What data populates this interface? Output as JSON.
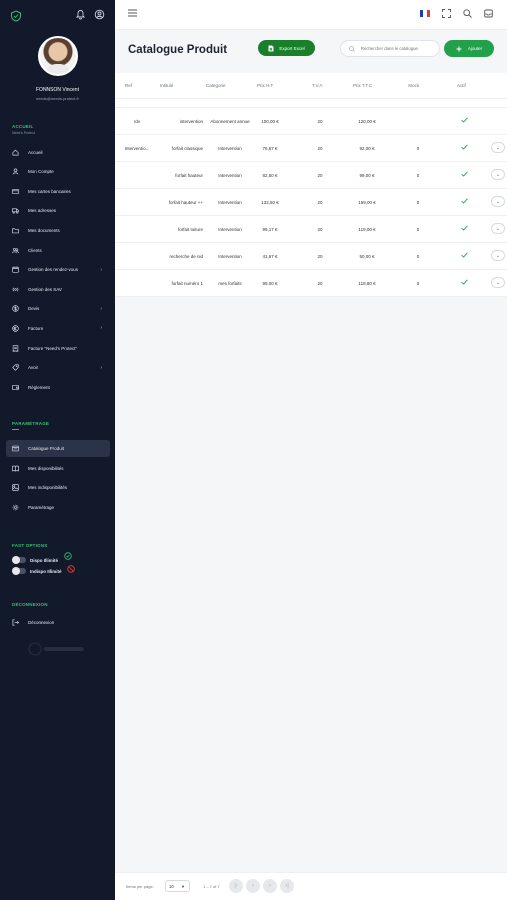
{
  "user": {
    "name": "FONNSON Vincent",
    "email": "needs@needs-protect.fr"
  },
  "sidebar": {
    "section_access": "ACCUEIL",
    "section_access_sub": "Need's Protect",
    "items": [
      {
        "label": "Accueil",
        "icon": "home-icon",
        "arrow": ""
      },
      {
        "label": "Mon Compte",
        "icon": "user-icon",
        "arrow": ""
      },
      {
        "label": "Mes cartes bancaires",
        "icon": "card-icon",
        "arrow": ""
      },
      {
        "label": "Mes adresses",
        "icon": "truck-icon",
        "arrow": ""
      },
      {
        "label": "Mes documents",
        "icon": "folder-icon",
        "arrow": ""
      },
      {
        "label": "Clients",
        "icon": "users-icon",
        "arrow": ""
      },
      {
        "label": "Gestion des rendez-vous",
        "icon": "calendar-icon",
        "arrow": "›"
      },
      {
        "label": "Gestion des SAV",
        "icon": "radio-icon",
        "arrow": ""
      },
      {
        "label": "Devis",
        "icon": "dollar-icon",
        "arrow": "›"
      },
      {
        "label": "Facture",
        "icon": "euro-icon",
        "arrow": "›"
      },
      {
        "label": "Facture \"Need's Protect\"",
        "icon": "receipt-icon",
        "arrow": ""
      },
      {
        "label": "Avoir",
        "icon": "tag-icon",
        "arrow": "›"
      },
      {
        "label": "Règlement",
        "icon": "wallet-icon",
        "arrow": ""
      }
    ],
    "section_settings": "PARAMÉTRAGE",
    "settings_items": [
      {
        "label": "Catalogue Produit",
        "icon": "catalog-icon"
      },
      {
        "label": "Mes disponibilités",
        "icon": "book-icon"
      },
      {
        "label": "Mes indisponibilités",
        "icon": "image-icon"
      },
      {
        "label": "Paramétrage",
        "icon": "gear-icon"
      }
    ],
    "section_fast": "FAST OPTIONS",
    "toggles": [
      {
        "label": "Dispo Illimité"
      },
      {
        "label": "Indispo Illimité"
      }
    ],
    "section_logout": "DÉCONNEXION",
    "logout_label": "Déconnexion"
  },
  "header": {
    "title": "Catalogue Produit",
    "export_label": "Export Excel",
    "search_placeholder": "Rechercher dans le catalogue",
    "add_label": "Ajouter"
  },
  "table": {
    "columns": [
      "Ref",
      "Intitulé",
      "Categorie",
      "Prix H.T",
      "T.V.A",
      "Prix T.T.C",
      "Stock",
      "Actif"
    ],
    "rows": [
      {
        "ref": "rdv",
        "intitule": "intervention",
        "categorie": "Abonnement annue",
        "prix_ht": "100,00 €",
        "tva": "20",
        "prix_ttc": "120,00 €",
        "stock": "",
        "actif": true,
        "expand": false
      },
      {
        "ref": "Interventio...",
        "intitule": "forfait classique",
        "categorie": "Intervention",
        "prix_ht": "76,67 €",
        "tva": "20",
        "prix_ttc": "92,00 €",
        "stock": "0",
        "actif": true,
        "expand": true
      },
      {
        "ref": "",
        "intitule": "forfait hauteur",
        "categorie": "Intervention",
        "prix_ht": "82,50 €",
        "tva": "20",
        "prix_ttc": "99,00 €",
        "stock": "0",
        "actif": true,
        "expand": true
      },
      {
        "ref": "",
        "intitule": "forfait hauteur ++",
        "categorie": "Intervention",
        "prix_ht": "132,50 €",
        "tva": "20",
        "prix_ttc": "159,00 €",
        "stock": "0",
        "actif": true,
        "expand": true
      },
      {
        "ref": "",
        "intitule": "forfait toiture",
        "categorie": "Intervention",
        "prix_ht": "99,17 €",
        "tva": "20",
        "prix_ttc": "119,00 €",
        "stock": "0",
        "actif": true,
        "expand": true
      },
      {
        "ref": "",
        "intitule": "recherche de nid",
        "categorie": "Intervention",
        "prix_ht": "41,67 €",
        "tva": "20",
        "prix_ttc": "50,00 €",
        "stock": "0",
        "actif": true,
        "expand": true
      },
      {
        "ref": "",
        "intitule": "forfait numéro 1",
        "categorie": "mes forfaits",
        "prix_ht": "99,00 €",
        "tva": "20",
        "prix_ttc": "118,80 €",
        "stock": "0",
        "actif": true,
        "expand": true
      }
    ]
  },
  "footer": {
    "items_per_page_label": "Items per page:",
    "items_per_page_value": "10",
    "range": "1 – 7 of 7"
  },
  "colors": {
    "sidebar": "#12192b",
    "accent": "#22a04a",
    "export": "#1a7f2a",
    "section": "#38c173"
  }
}
